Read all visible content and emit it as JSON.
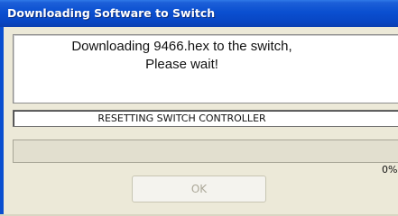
{
  "window": {
    "title": "Downloading Software to Switch"
  },
  "message": {
    "line1": "Downloading 9466.hex to the switch,",
    "line2": "Please wait!"
  },
  "status": {
    "text": "RESETTING SWITCH CONTROLLER"
  },
  "progress": {
    "percent_label": "0%",
    "value": 0
  },
  "buttons": {
    "ok_label": "OK",
    "ok_enabled": false
  },
  "colors": {
    "titlebar": "#0a4fd0",
    "dialog_bg": "#ece9d8",
    "disabled_text": "#aca899"
  }
}
